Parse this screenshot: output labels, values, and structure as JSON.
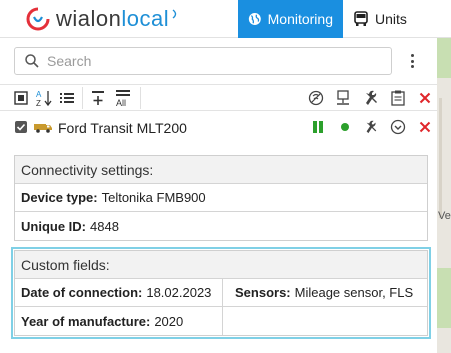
{
  "header": {
    "logo_part1": "wialon",
    "logo_part2": "local",
    "tabs": [
      {
        "label": "Monitoring",
        "active": true,
        "icon": "globe-icon"
      },
      {
        "label": "Units",
        "active": false,
        "icon": "bus-icon"
      }
    ]
  },
  "search": {
    "placeholder": "Search",
    "value": ""
  },
  "toolbar": {
    "left_icons": [
      "select-all-icon",
      "sort-az-icon",
      "list-icon",
      "add-group-icon",
      "show-all-icon"
    ],
    "all_label": "All",
    "right_icons": [
      "signal-icon",
      "network-icon",
      "wrench-icon",
      "clipboard-icon",
      "close-icon"
    ]
  },
  "unit": {
    "name": "Ford Transit MLT200",
    "checked": true,
    "status_color": "#2ca02c",
    "icons": [
      "pause-icon",
      "online-dot-icon",
      "wrench-icon",
      "chevron-down-icon",
      "close-icon"
    ]
  },
  "connectivity": {
    "title": "Connectivity settings:",
    "device_type_label": "Device type:",
    "device_type_value": "Teltonika FMB900",
    "unique_id_label": "Unique ID:",
    "unique_id_value": "4848"
  },
  "custom_fields": {
    "title": "Custom fields:",
    "date_label": "Date of connection:",
    "date_value": "18.02.2023",
    "sensors_label": "Sensors:",
    "sensors_value": "Mileage sensor, FLS",
    "year_label": "Year of manufacture:",
    "year_value": "2020"
  },
  "map": {
    "fragment_text": "Veli"
  },
  "colors": {
    "accent": "#1a8fe0",
    "danger": "#e0262b",
    "online": "#2ca02c",
    "highlight": "#7fd0e6"
  }
}
